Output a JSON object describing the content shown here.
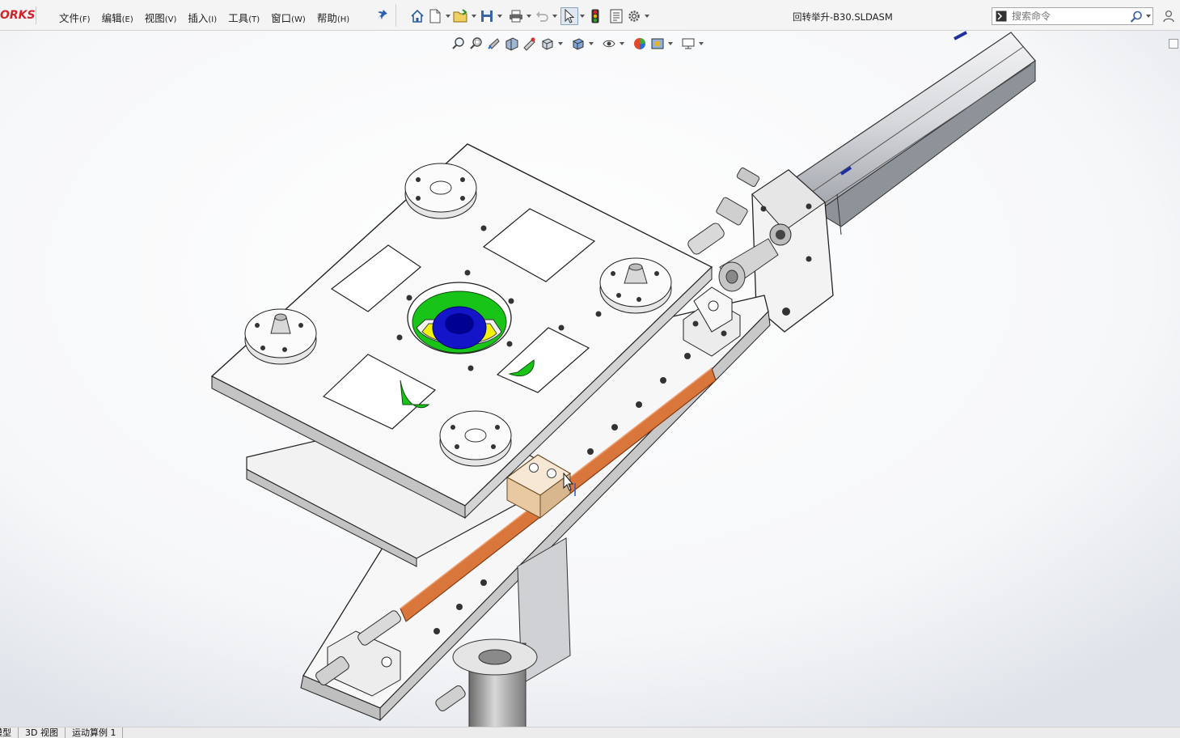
{
  "app": {
    "logo_text": "ORKS",
    "brand_color": "#d2232a"
  },
  "menu": [
    {
      "label": "文件",
      "key": "(F)"
    },
    {
      "label": "编辑",
      "key": "(E)"
    },
    {
      "label": "视图",
      "key": "(V)"
    },
    {
      "label": "插入",
      "key": "(I)"
    },
    {
      "label": "工具",
      "key": "(T)"
    },
    {
      "label": "窗口",
      "key": "(W)"
    },
    {
      "label": "帮助",
      "key": "(H)"
    }
  ],
  "toolbar_icons": [
    "home-icon",
    "new-document-icon",
    "open-folder-icon",
    "save-icon",
    "print-icon",
    "undo-icon",
    "select-cursor-icon",
    "rebuild-traffic-light-icon",
    "file-properties-icon",
    "options-gear-icon"
  ],
  "document_title": "回转举升-B30.SLDASM",
  "search": {
    "placeholder": "搜索命令"
  },
  "heads_up_icons": [
    "zoom-to-fit-icon",
    "zoom-to-area-icon",
    "previous-view-icon",
    "section-view-icon",
    "dynamic-annotation-icon",
    "view-orientation-icon",
    "display-style-icon",
    "hide-show-items-icon",
    "edit-appearance-icon",
    "apply-scene-icon",
    "view-settings-icon"
  ],
  "status_tabs": [
    "模型",
    "3D 视图",
    "运动算例 1"
  ],
  "colors": {
    "accent_green": "#18c418",
    "accent_blue": "#1414c8",
    "accent_yellow": "#f2f20a",
    "rail_copper": "#d9763c"
  }
}
